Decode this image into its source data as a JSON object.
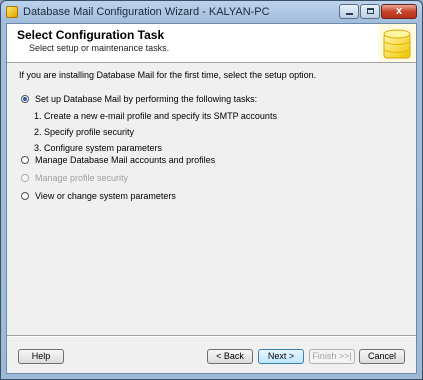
{
  "window": {
    "title": "Database Mail Configuration Wizard - KALYAN-PC",
    "close_glyph": "x"
  },
  "header": {
    "title": "Select Configuration Task",
    "subtitle": "Select setup or maintenance tasks."
  },
  "intro_text": "If you are installing Database Mail for the first time, select the setup option.",
  "options": [
    {
      "label": "Set up Database Mail by performing the following tasks:",
      "checked": true,
      "enabled": true
    },
    {
      "label": "Manage Database Mail accounts and profiles",
      "checked": false,
      "enabled": true
    },
    {
      "label": "Manage profile security",
      "checked": false,
      "enabled": false
    },
    {
      "label": "View or change system parameters",
      "checked": false,
      "enabled": true
    }
  ],
  "setup_tasks": [
    "1. Create a new e-mail profile and specify its SMTP accounts",
    "2. Specify profile security",
    "3. Configure system parameters"
  ],
  "buttons": {
    "help": "Help",
    "back": "< Back",
    "next": "Next >",
    "finish": "Finish >>|",
    "cancel": "Cancel"
  }
}
